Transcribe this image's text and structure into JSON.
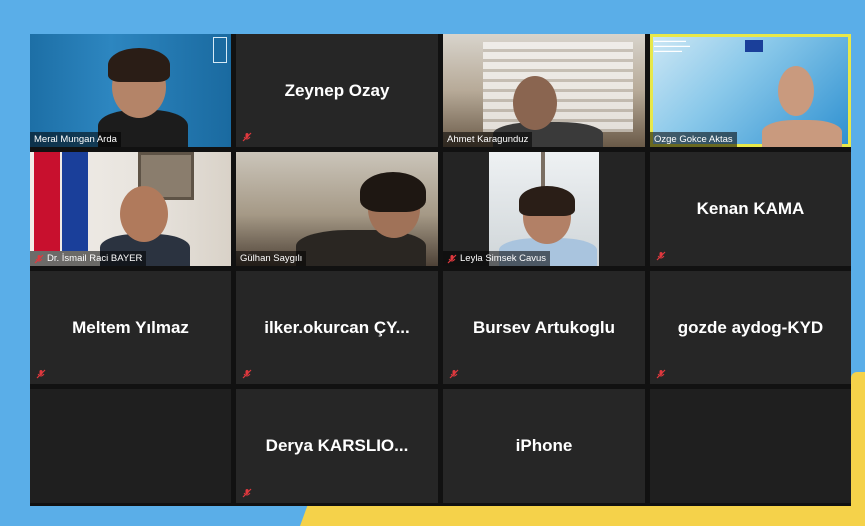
{
  "participants": [
    {
      "name": "Meral Mungan Arda",
      "video": true,
      "muted": false
    },
    {
      "name": "Zeynep Ozay",
      "video": false,
      "muted": true
    },
    {
      "name": "Ahmet Karagunduz",
      "video": true,
      "muted": false
    },
    {
      "name": "Ozge Gokce Aktas",
      "video": true,
      "muted": false,
      "active_speaker": true
    },
    {
      "name": "Dr. İsmail Raci BAYER",
      "video": true,
      "muted": true
    },
    {
      "name": "Gülhan Saygılı",
      "video": true,
      "muted": false
    },
    {
      "name": "Leyla Simsek Cavus",
      "video": true,
      "muted": true
    },
    {
      "name": "Kenan KAMA",
      "video": false,
      "muted": true
    },
    {
      "name": "Meltem Yılmaz",
      "video": false,
      "muted": true
    },
    {
      "name": "ilker.okurcan  ÇY...",
      "video": false,
      "muted": true
    },
    {
      "name": "Bursev Artukoglu",
      "video": false,
      "muted": true
    },
    {
      "name": "gozde aydog-KYD",
      "video": false,
      "muted": true
    },
    {
      "name": "Derya  KARSLIO...",
      "video": false,
      "muted": true
    },
    {
      "name": "iPhone",
      "video": false,
      "muted": false
    }
  ],
  "colors": {
    "background": "#5aaee8",
    "accent_yellow": "#f5d24a",
    "tile": "#262626",
    "mic_off": "#e0383e",
    "active_outline": "#e8e84a"
  },
  "icons": {
    "muted": "mic-off-icon"
  }
}
